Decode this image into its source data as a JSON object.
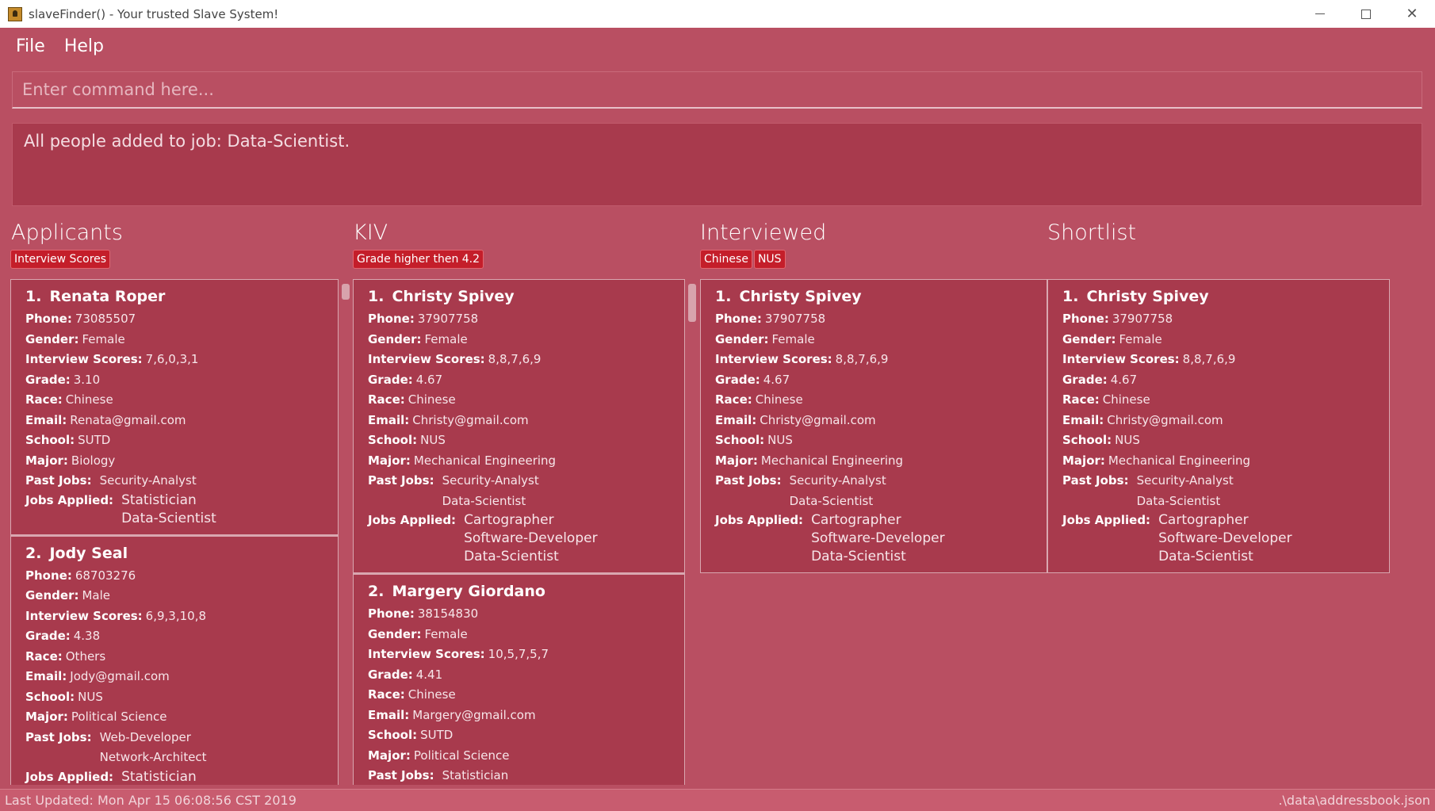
{
  "window": {
    "title": "slaveFinder() - Your trusted Slave System!"
  },
  "menu": [
    "File",
    "Help"
  ],
  "command": {
    "placeholder": "Enter command here..."
  },
  "result": {
    "message": "All people added to job: Data-Scientist."
  },
  "columns": [
    {
      "title": "Applicants",
      "tags": [
        "Interview Scores"
      ],
      "people": [
        {
          "index": "1.",
          "name": "Renata Roper",
          "phone": "73085507",
          "gender": "Female",
          "interview_scores": "7,6,0,3,1",
          "grade": "3.10",
          "race": "Chinese",
          "email": "Renata@gmail.com",
          "school": "SUTD",
          "major": "Biology",
          "past_jobs": [
            "Security-Analyst"
          ],
          "jobs_applied": [
            "Statistician",
            "Data-Scientist"
          ]
        },
        {
          "index": "2.",
          "name": "Jody Seal",
          "phone": "68703276",
          "gender": "Male",
          "interview_scores": "6,9,3,10,8",
          "grade": "4.38",
          "race": "Others",
          "email": "Jody@gmail.com",
          "school": "NUS",
          "major": "Political Science",
          "past_jobs": [
            "Web-Developer",
            "Network-Architect"
          ],
          "jobs_applied": [
            "Statistician"
          ]
        }
      ]
    },
    {
      "title": "KIV",
      "tags": [
        "Grade higher then 4.2"
      ],
      "people": [
        {
          "index": "1.",
          "name": "Christy Spivey",
          "phone": "37907758",
          "gender": "Female",
          "interview_scores": "8,8,7,6,9",
          "grade": "4.67",
          "race": "Chinese",
          "email": "Christy@gmail.com",
          "school": "NUS",
          "major": "Mechanical Engineering",
          "past_jobs": [
            "Security-Analyst",
            "Data-Scientist"
          ],
          "jobs_applied": [
            "Cartographer",
            "Software-Developer",
            "Data-Scientist"
          ]
        },
        {
          "index": "2.",
          "name": "Margery Giordano",
          "phone": "38154830",
          "gender": "Female",
          "interview_scores": "10,5,7,5,7",
          "grade": "4.41",
          "race": "Chinese",
          "email": "Margery@gmail.com",
          "school": "SUTD",
          "major": "Political Science",
          "past_jobs": [
            "Statistician"
          ],
          "jobs_applied": []
        }
      ]
    },
    {
      "title": "Interviewed",
      "tags": [
        "Chinese",
        "NUS"
      ],
      "people": [
        {
          "index": "1.",
          "name": "Christy Spivey",
          "phone": "37907758",
          "gender": "Female",
          "interview_scores": "8,8,7,6,9",
          "grade": "4.67",
          "race": "Chinese",
          "email": "Christy@gmail.com",
          "school": "NUS",
          "major": "Mechanical Engineering",
          "past_jobs": [
            "Security-Analyst",
            "Data-Scientist"
          ],
          "jobs_applied": [
            "Cartographer",
            "Software-Developer",
            "Data-Scientist"
          ]
        }
      ]
    },
    {
      "title": "Shortlist",
      "tags": [],
      "people": [
        {
          "index": "1.",
          "name": "Christy Spivey",
          "phone": "37907758",
          "gender": "Female",
          "interview_scores": "8,8,7,6,9",
          "grade": "4.67",
          "race": "Chinese",
          "email": "Christy@gmail.com",
          "school": "NUS",
          "major": "Mechanical Engineering",
          "past_jobs": [
            "Security-Analyst",
            "Data-Scientist"
          ],
          "jobs_applied": [
            "Cartographer",
            "Software-Developer",
            "Data-Scientist"
          ]
        }
      ]
    }
  ],
  "field_labels": {
    "phone": "Phone:",
    "gender": "Gender:",
    "interview_scores": "Interview Scores:",
    "grade": "Grade:",
    "race": "Race:",
    "email": "Email:",
    "school": "School:",
    "major": "Major:",
    "past_jobs": "Past Jobs:",
    "jobs_applied": "Jobs Applied:"
  },
  "status": {
    "last_updated": "Last Updated: Mon Apr 15 06:08:56 CST 2019",
    "file_path": ".\\data\\addressbook.json"
  }
}
